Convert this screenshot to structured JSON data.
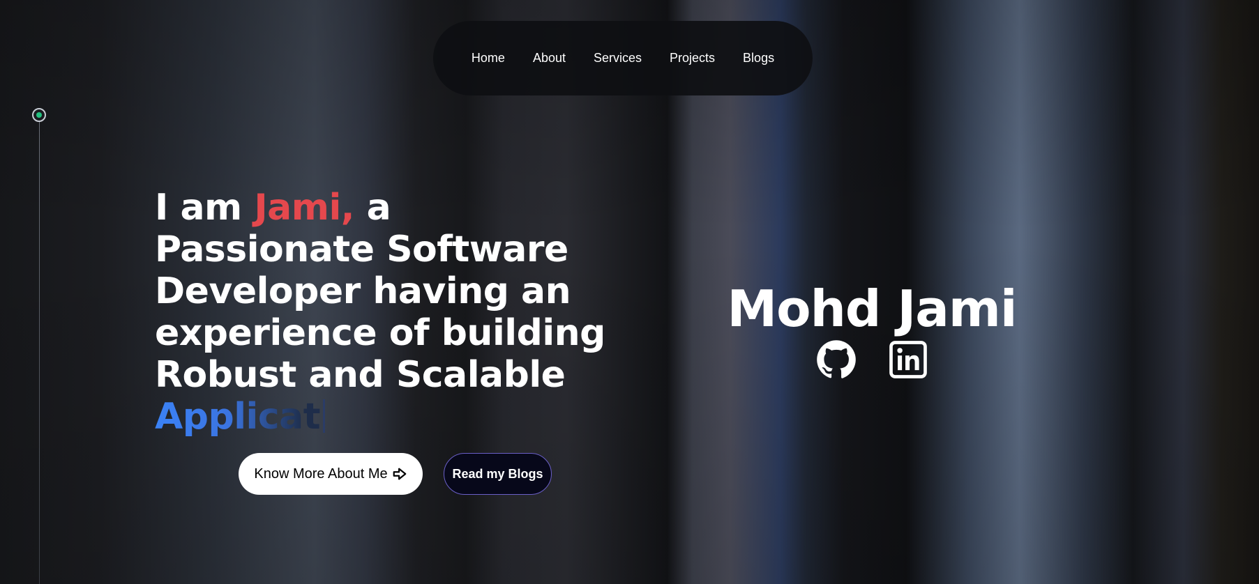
{
  "nav": {
    "items": [
      {
        "label": "Home"
      },
      {
        "label": "About"
      },
      {
        "label": "Services"
      },
      {
        "label": "Projects"
      },
      {
        "label": "Blogs"
      }
    ]
  },
  "hero": {
    "intro_prefix": "I am ",
    "intro_name": "Jami,",
    "intro_suffix": " a",
    "line2": "Passionate Software",
    "line3": "Developer having an",
    "line4": "experience of building",
    "line5": "Robust and Scalable",
    "typing_text": "Applicat"
  },
  "buttons": {
    "know_more": "Know More About Me",
    "read_blogs": "Read my Blogs"
  },
  "profile": {
    "full_name": "Mohd Jami",
    "socials": [
      {
        "icon": "github-icon"
      },
      {
        "icon": "linkedin-icon"
      }
    ]
  },
  "colors": {
    "accent_red": "#e5484d",
    "accent_blue": "#3b82f6",
    "timeline_dot": "#22c07f"
  }
}
